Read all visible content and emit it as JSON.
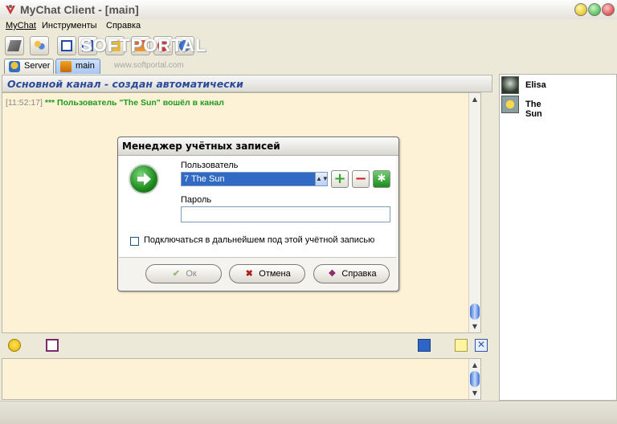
{
  "window": {
    "title": "MyChat Client - [main]",
    "icon": "mychat-app-icon",
    "controls": [
      "minimize-icon",
      "maximize-icon",
      "close-icon"
    ]
  },
  "menu": {
    "items": [
      "MyChat",
      "Инструменты",
      "Справка"
    ]
  },
  "toolbar": {
    "icons": [
      "connect-icon",
      "users-icon",
      "window-icon",
      "network-icon",
      "settings-icon",
      "user-profile-icon",
      "back-icon",
      "help-icon"
    ]
  },
  "watermark": {
    "text": "SOFTPORTAL",
    "sub": "www.softportal.com"
  },
  "tabs": [
    {
      "label": "Server",
      "icon": "server-icon",
      "active": false
    },
    {
      "label": "main",
      "icon": "channel-icon",
      "active": true
    }
  ],
  "channel": {
    "header": "Основной канал - создан автоматически",
    "messages": [
      {
        "time": "[11:52:17]",
        "text": "*** Пользователь \"The Sun\" вошёл в канал",
        "color": "#1f9a1f"
      }
    ]
  },
  "input_toolbar": {
    "left_icons": [
      "smiley-icon",
      "book-icon"
    ],
    "right_icons": [
      "save-icon",
      "new-document-icon",
      "clear-icon"
    ]
  },
  "users": [
    {
      "name": "Elisa"
    },
    {
      "name": "The Sun"
    }
  ],
  "dialog": {
    "title": "Менеджер учётных записей",
    "user_label": "Пользователь",
    "user_value": "7 The Sun",
    "password_label": "Пароль",
    "password_value": "",
    "remember_label": "Подключаться в дальнейшем под этой учётной записью",
    "remember_checked": false,
    "buttons": {
      "ok": "Ок",
      "cancel": "Отмена",
      "help": "Справка"
    }
  },
  "colors": {
    "chat_bg": "#fdf1d6",
    "header_text": "#2b4b9a",
    "system_message": "#1f9a1f",
    "selection": "#316ac5"
  }
}
